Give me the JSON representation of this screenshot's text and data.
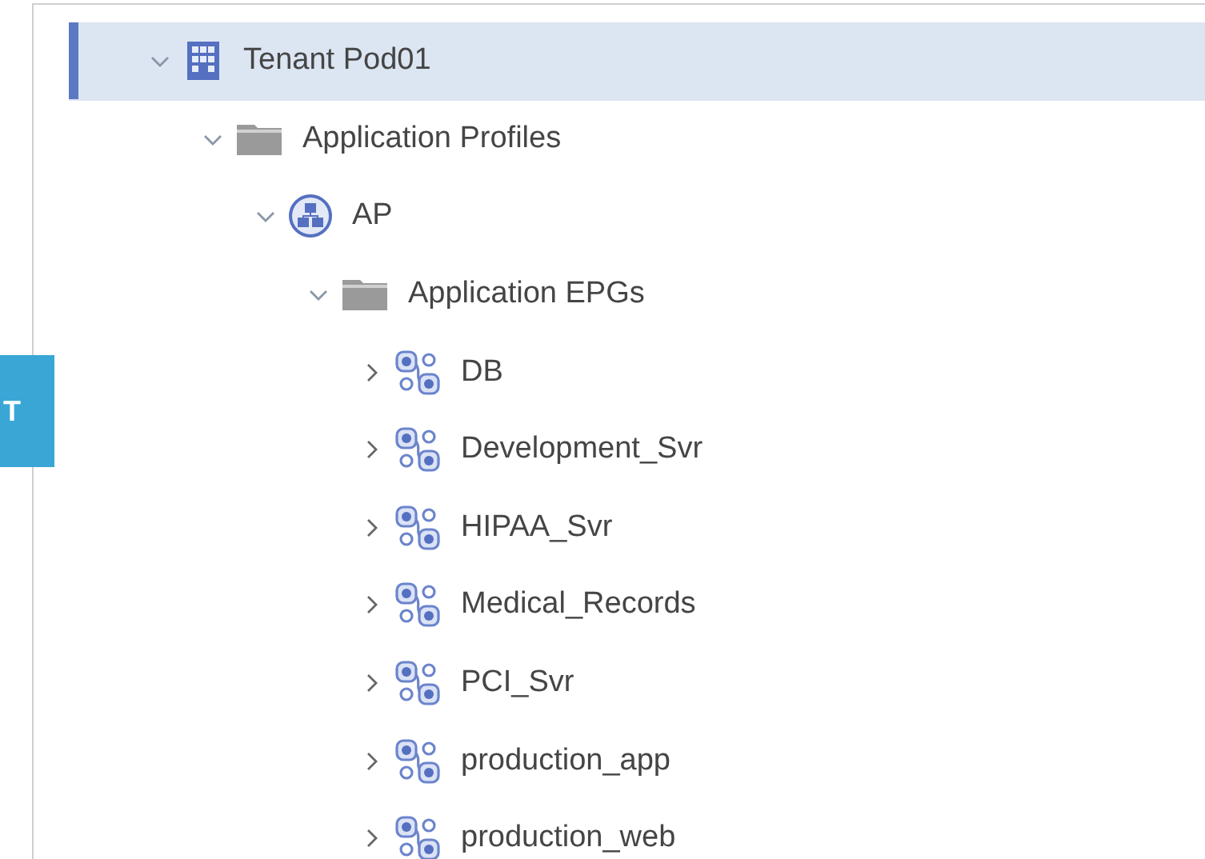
{
  "side_tab": {
    "label": "T"
  },
  "tree": [
    {
      "label": "Tenant Pod01",
      "kind": "tenant",
      "expanded": true,
      "selected": true,
      "children": [
        {
          "label": "Application Profiles",
          "kind": "folder",
          "expanded": true,
          "selected": false,
          "children": [
            {
              "label": "AP",
              "kind": "ap",
              "expanded": true,
              "selected": false,
              "children": [
                {
                  "label": "Application EPGs",
                  "kind": "folder",
                  "expanded": true,
                  "selected": false,
                  "children": [
                    {
                      "label": "DB",
                      "kind": "epg",
                      "expanded": false,
                      "selected": false
                    },
                    {
                      "label": "Development_Svr",
                      "kind": "epg",
                      "expanded": false,
                      "selected": false
                    },
                    {
                      "label": "HIPAA_Svr",
                      "kind": "epg",
                      "expanded": false,
                      "selected": false
                    },
                    {
                      "label": "Medical_Records",
                      "kind": "epg",
                      "expanded": false,
                      "selected": false
                    },
                    {
                      "label": "PCI_Svr",
                      "kind": "epg",
                      "expanded": false,
                      "selected": false
                    },
                    {
                      "label": "production_app",
                      "kind": "epg",
                      "expanded": false,
                      "selected": false
                    },
                    {
                      "label": "production_web",
                      "kind": "epg",
                      "expanded": false,
                      "selected": false
                    }
                  ]
                }
              ]
            }
          ]
        }
      ]
    }
  ]
}
